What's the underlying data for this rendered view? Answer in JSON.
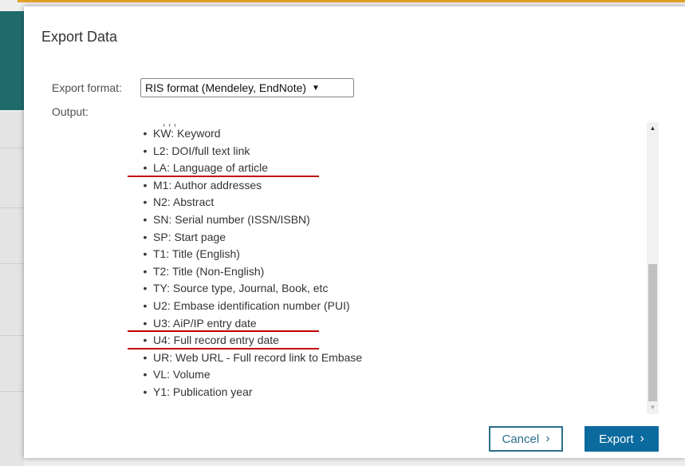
{
  "dialog": {
    "title": "Export Data",
    "format_label": "Export format:",
    "format_value": "RIS format (Mendeley, EndNote)",
    "output_label": "Output:",
    "fields": [
      {
        "text": "KW: Keyword",
        "highlight": false
      },
      {
        "text": "L2: DOI/full text link",
        "highlight": false
      },
      {
        "text": "LA: Language of article",
        "highlight": true
      },
      {
        "text": "M1: Author addresses",
        "highlight": false
      },
      {
        "text": "N2: Abstract",
        "highlight": false
      },
      {
        "text": "SN: Serial number (ISSN/ISBN)",
        "highlight": false
      },
      {
        "text": "SP: Start page",
        "highlight": false
      },
      {
        "text": "T1: Title (English)",
        "highlight": false
      },
      {
        "text": "T2: Title (Non-English)",
        "highlight": false
      },
      {
        "text": "TY: Source type, Journal, Book, etc",
        "highlight": false
      },
      {
        "text": "U2: Embase identification number (PUI)",
        "highlight": false
      },
      {
        "text": "U3: AiP/IP entry date",
        "highlight": true
      },
      {
        "text": "U4: Full record entry date",
        "highlight": true
      },
      {
        "text": "UR: Web URL - Full record link to Embase",
        "highlight": false
      },
      {
        "text": "VL: Volume",
        "highlight": false
      },
      {
        "text": "Y1: Publication year",
        "highlight": false
      }
    ],
    "cancel_label": "Cancel",
    "export_label": "Export",
    "chevron_glyph": "›",
    "select_arrow_glyph": "▼",
    "bullet_glyph": "•"
  },
  "colors": {
    "highlight_underline": "#c00000",
    "primary_button": "#0b6a9e",
    "secondary_button_border": "#2a6f8a",
    "sidebar_teal": "#1f6b6b",
    "top_border": "#e0a126"
  }
}
